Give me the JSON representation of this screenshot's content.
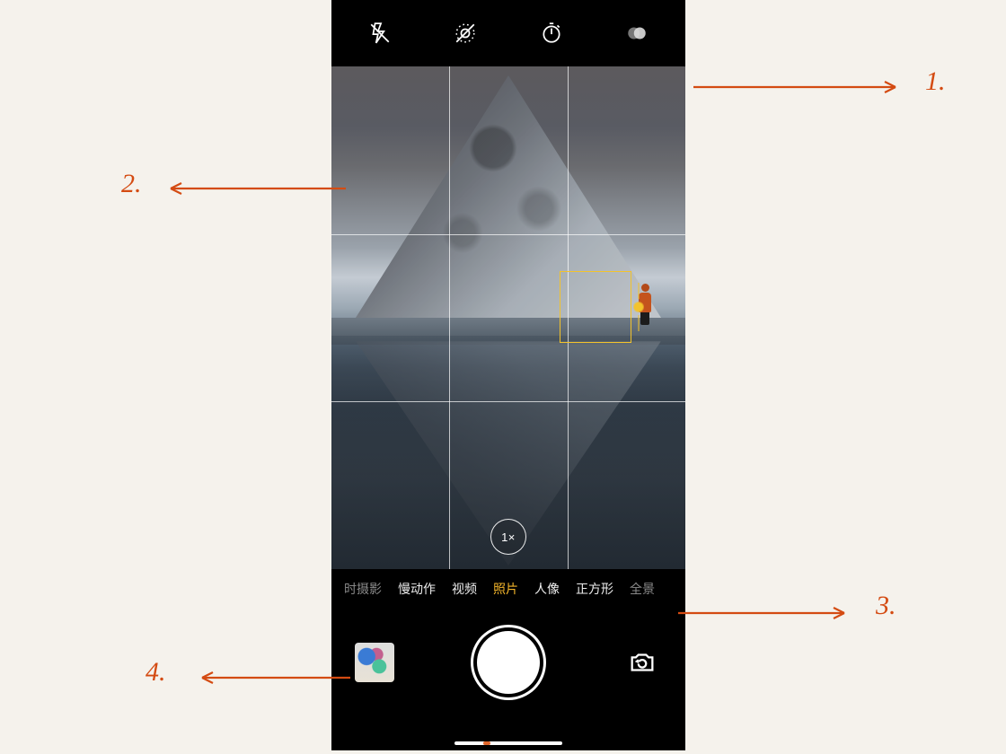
{
  "topbar": {
    "icons": [
      "flash-off",
      "live-photo-off",
      "timer",
      "filters"
    ]
  },
  "viewfinder": {
    "focus_box_visible": true,
    "rule_of_thirds_grid": true
  },
  "zoom": {
    "label": "1×"
  },
  "modes": {
    "items": [
      {
        "label": "时摄影",
        "style": "dim"
      },
      {
        "label": "慢动作",
        "style": "normal"
      },
      {
        "label": "视频",
        "style": "normal"
      },
      {
        "label": "照片",
        "style": "active"
      },
      {
        "label": "人像",
        "style": "normal"
      },
      {
        "label": "正方形",
        "style": "normal"
      },
      {
        "label": "全景",
        "style": "dim"
      }
    ]
  },
  "annotations": {
    "n1": "1.",
    "n2": "2.",
    "n3": "3.",
    "n4": "4."
  },
  "colors": {
    "accent": "#f3b52b",
    "annotation": "#d44b12"
  }
}
